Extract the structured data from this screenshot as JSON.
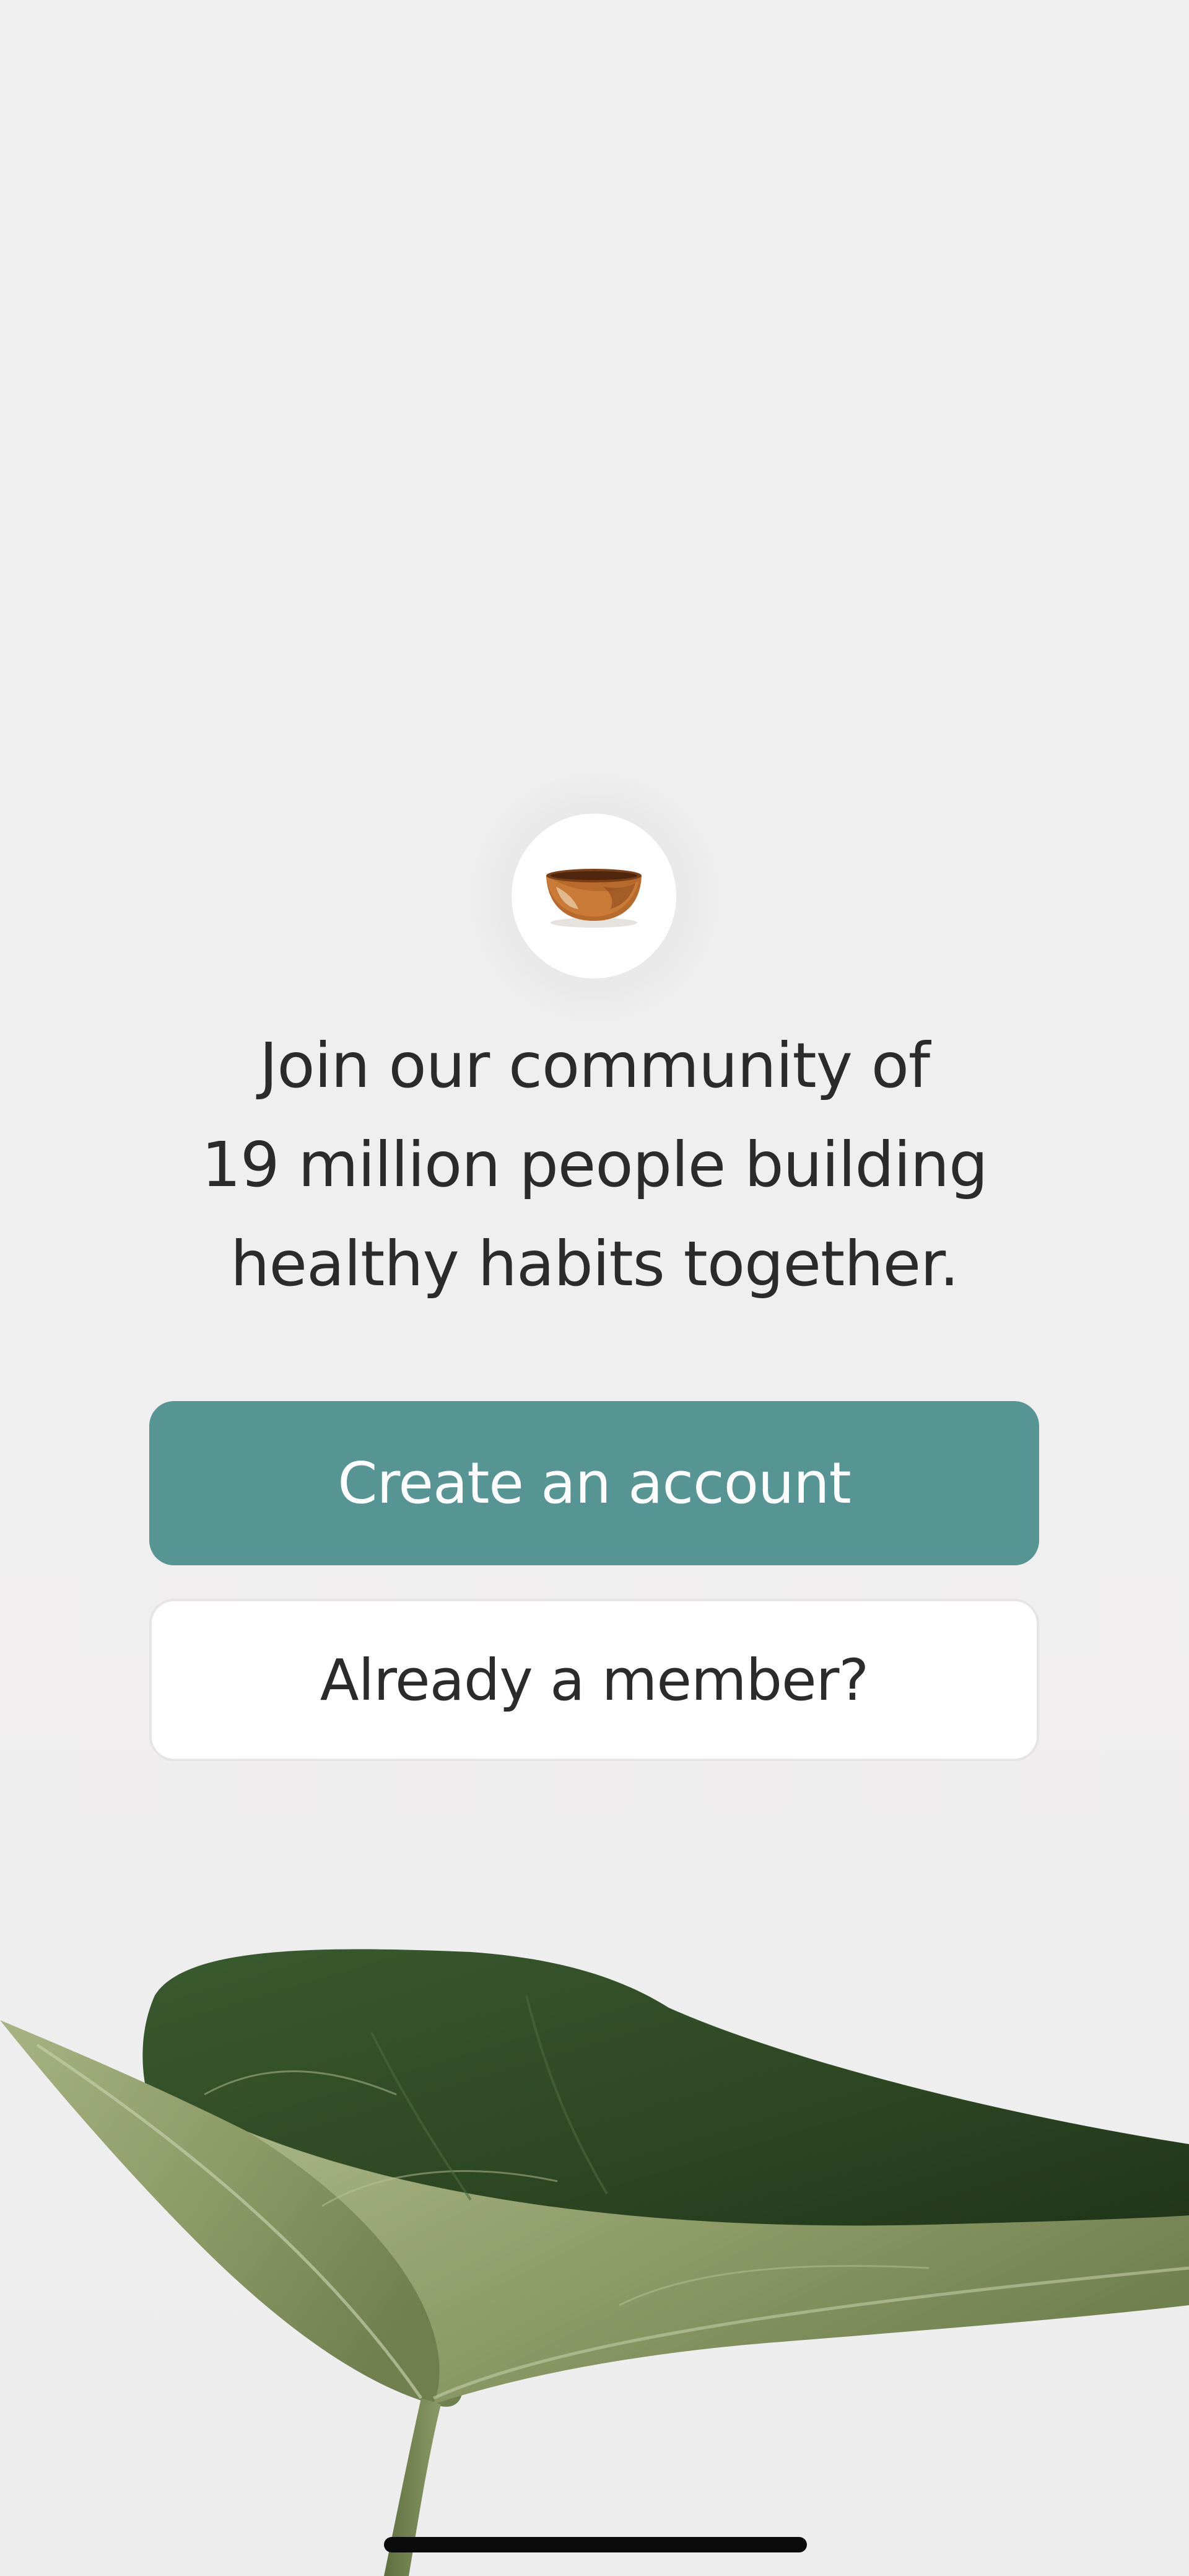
{
  "logo": {
    "icon": "singing-bowl-icon"
  },
  "headline": {
    "line1": "Join our community of",
    "line2": "19 million people building",
    "line3": "healthy habits together."
  },
  "actions": {
    "create_account_label": "Create an account",
    "member_label": "Already a member?"
  },
  "colors": {
    "background": "#f0efef",
    "primary_button": "#579494",
    "primary_button_text": "#ffffff",
    "secondary_button": "#ffffff",
    "text": "#2b2b2b",
    "leaf_dark": "#2f4a26",
    "leaf_light": "#8d9b68"
  }
}
